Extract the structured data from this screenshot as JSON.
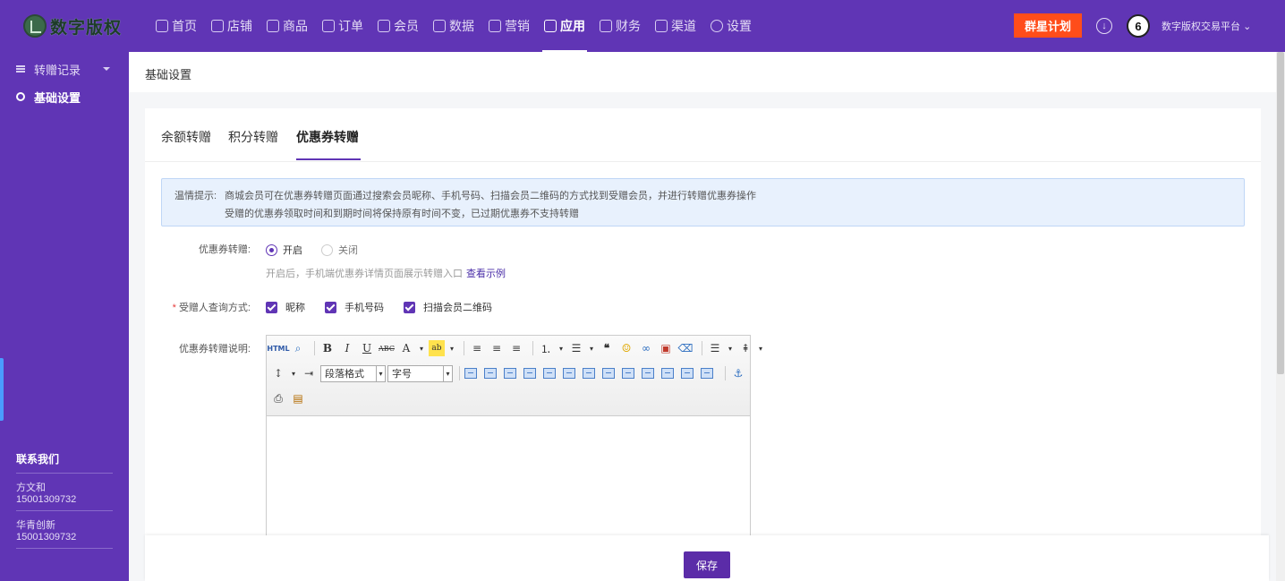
{
  "brand": {
    "name": "数字版权"
  },
  "nav": [
    {
      "label": "首页",
      "icon": "home-icon"
    },
    {
      "label": "店铺",
      "icon": "store-icon"
    },
    {
      "label": "商品",
      "icon": "goods-icon"
    },
    {
      "label": "订单",
      "icon": "order-icon"
    },
    {
      "label": "会员",
      "icon": "member-icon"
    },
    {
      "label": "数据",
      "icon": "data-icon"
    },
    {
      "label": "营销",
      "icon": "tag-icon"
    },
    {
      "label": "应用",
      "icon": "app-icon",
      "active": true
    },
    {
      "label": "财务",
      "icon": "finance-icon"
    },
    {
      "label": "渠道",
      "icon": "channel-icon"
    },
    {
      "label": "设置",
      "icon": "gear-icon"
    }
  ],
  "header": {
    "promo_label": "群星计划",
    "account_name": "数字版权交易平台"
  },
  "sidebar": {
    "items": [
      {
        "label": "转赠记录",
        "icon": "list-icon"
      },
      {
        "label": "基础设置",
        "icon": "gear-icon",
        "active": true
      }
    ],
    "contact_title": "联系我们",
    "contacts": [
      {
        "name": "方文和",
        "phone": "15001309732"
      },
      {
        "name": "华青创新",
        "phone": "15001309732"
      }
    ]
  },
  "page": {
    "title": "基础设置"
  },
  "tabs": [
    {
      "label": "余额转赠"
    },
    {
      "label": "积分转赠"
    },
    {
      "label": "优惠券转赠",
      "active": true
    }
  ],
  "tip": {
    "label": "温情提示:",
    "line1": "商城会员可在优惠券转赠页面通过搜索会员昵称、手机号码、扫描会员二维码的方式找到受赠会员，并进行转赠优惠券操作",
    "line2": "受赠的优惠券领取时间和到期时间将保持原有时间不变，已过期优惠券不支持转赠"
  },
  "form": {
    "switch_label": "优惠券转赠:",
    "switch_on": "开启",
    "switch_off": "关闭",
    "switch_value": "开启",
    "hint": "开启后，手机端优惠券详情页面展示转赠入口",
    "hint_link": "查看示例",
    "query_label": "受赠人查询方式:",
    "query_options": [
      "昵称",
      "手机号码",
      "扫描会员二维码"
    ],
    "desc_label": "优惠券转赠说明:"
  },
  "editor": {
    "paragraph_select": "段落格式",
    "font_size_select": "字号",
    "html_label": "HTML"
  },
  "footer": {
    "save_label": "保存"
  },
  "colors": {
    "primary": "#6035b5",
    "promo": "#ff4d1a",
    "tip_bg": "#e8f1fd"
  }
}
